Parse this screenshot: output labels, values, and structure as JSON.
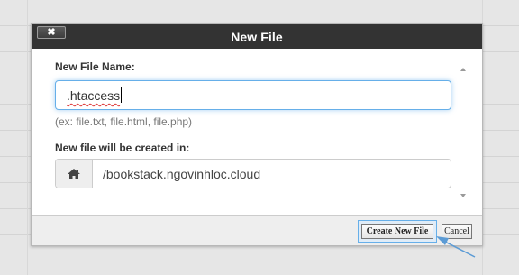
{
  "dialog": {
    "title": "New File",
    "close_label": "✖"
  },
  "form": {
    "file_name_label": "New File Name:",
    "file_name_value": ".htaccess",
    "file_name_hint": "(ex: file.txt, file.html, file.php)",
    "location_label": "New file will be created in:",
    "location_icon": "home-icon",
    "location_value": "/bookstack.ngovinhloc.cloud"
  },
  "footer": {
    "create_label": "Create New File",
    "cancel_label": "Cancel"
  },
  "colors": {
    "titlebar": "#333333",
    "focus": "#66afe9",
    "arrow": "#5b9bd5"
  }
}
